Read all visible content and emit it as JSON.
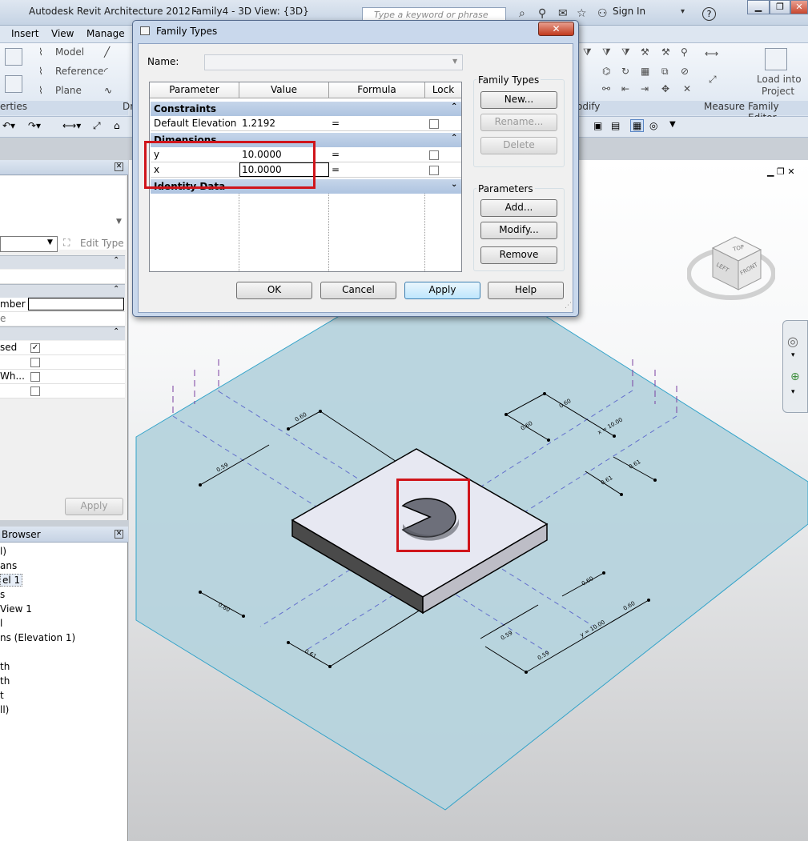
{
  "app": {
    "title": "Autodesk Revit Architecture 2012 -",
    "document": "Family4 - 3D View: {3D}",
    "search_placeholder": "Type a keyword or phrase",
    "sign_in": "Sign In",
    "help": "?"
  },
  "menu": [
    "Insert",
    "View",
    "Manage"
  ],
  "ribbon": {
    "model": "Model",
    "reference": "Reference",
    "plane": "Plane",
    "properties_group": "erties",
    "draw_group": "Dr",
    "modify_group": "odify",
    "measure_group": "Measure",
    "family_editor_group": "Family Editor",
    "load_into_project": "Load into",
    "load_into_project2": "Project"
  },
  "properties_panel": {
    "edit_type": "Edit Type",
    "rows": [
      "mber",
      "e",
      "sed",
      "Wh..."
    ],
    "apply": "Apply"
  },
  "project_browser": {
    "title": "Browser",
    "items": [
      "l)",
      "ans",
      "el 1",
      "s",
      "View 1",
      "l",
      "ns (Elevation 1)",
      "th",
      "th",
      "t",
      "ll)"
    ]
  },
  "dialog": {
    "title": "Family Types",
    "name_label": "Name:",
    "name_value": "",
    "columns": [
      "Parameter",
      "Value",
      "Formula",
      "Lock"
    ],
    "sections": {
      "constraints": "Constraints",
      "dimensions": "Dimensions",
      "identity": "Identity Data"
    },
    "rows": [
      {
        "param": "Default Elevation",
        "value": "1.2192",
        "formula": "="
      },
      {
        "param": "y",
        "value": "10.0000",
        "formula": "="
      },
      {
        "param": "x",
        "value": "10.0000",
        "formula": "="
      }
    ],
    "family_types_group": "Family Types",
    "new": "New...",
    "rename": "Rename...",
    "delete": "Delete",
    "parameters_group": "Parameters",
    "add": "Add...",
    "modify": "Modify...",
    "remove": "Remove",
    "ok": "OK",
    "cancel": "Cancel",
    "apply": "Apply",
    "help": "Help"
  },
  "viewcube": {
    "top": "TOP",
    "left": "LEFT",
    "front": "FRONT"
  },
  "dimensions": {
    "d060": "0.60",
    "d059": "0.59",
    "d061": "0.61",
    "x": "x = 10.00",
    "y": "y = 10.00"
  }
}
